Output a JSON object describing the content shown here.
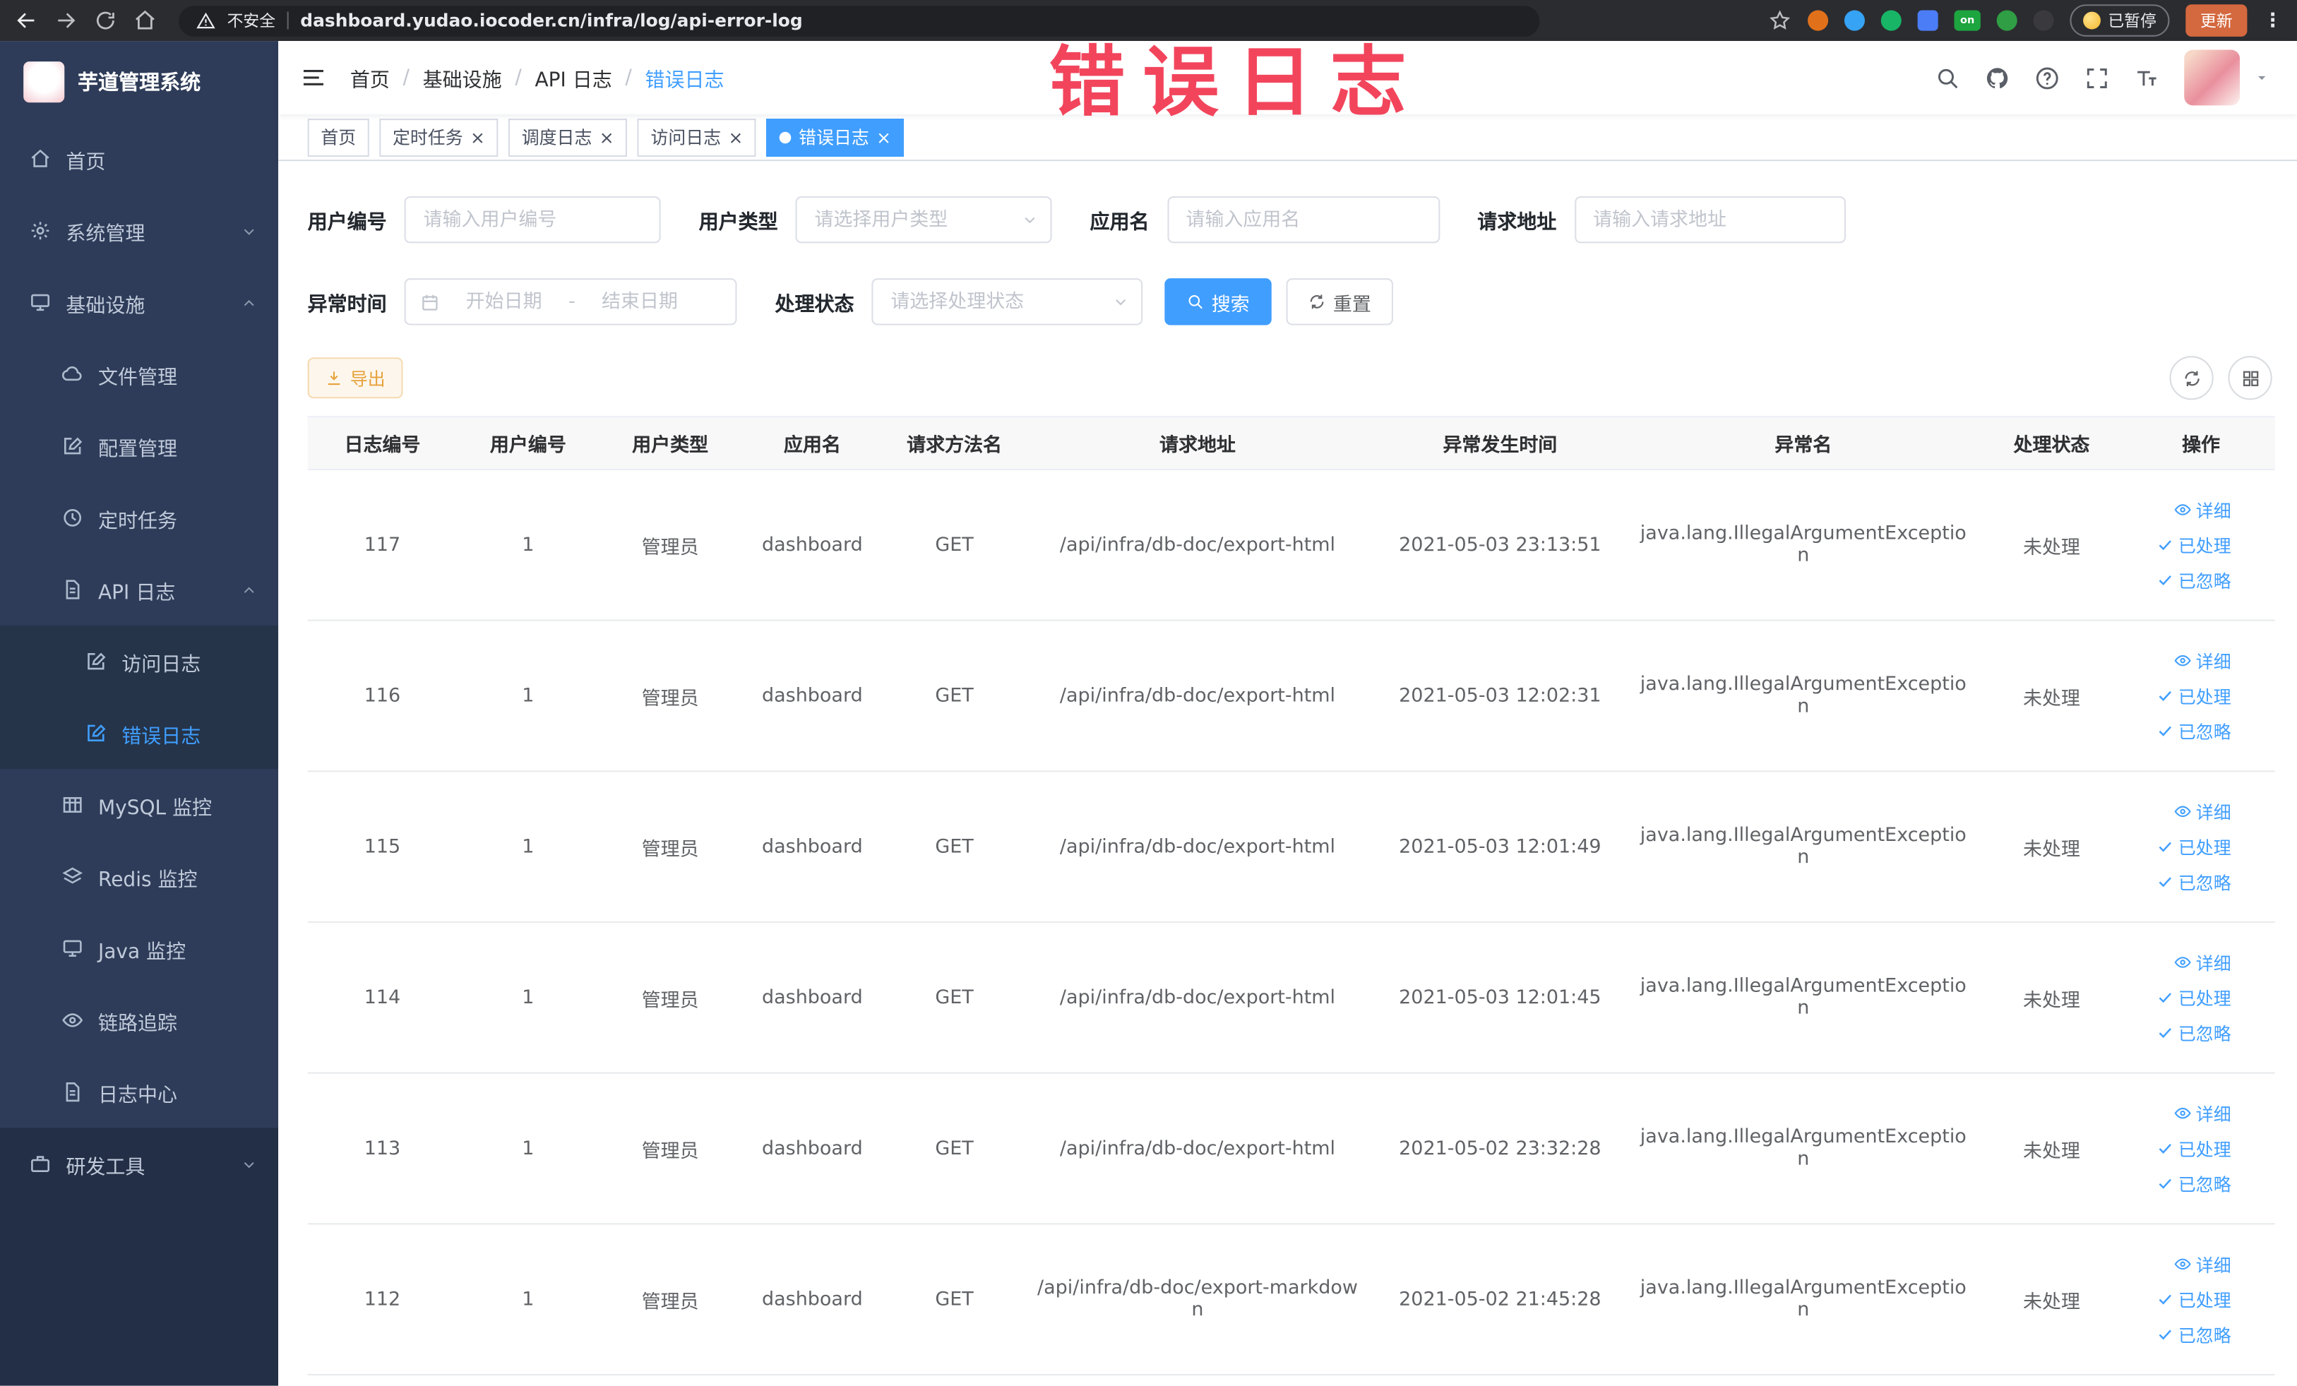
{
  "browser": {
    "security_text": "不安全",
    "url": "dashboard.yudao.iocoder.cn/infra/log/api-error-log",
    "ext_on": "on",
    "paused_badge": "已暂停",
    "update_label": "更新"
  },
  "annotation": {
    "text": "错误日志"
  },
  "sidebar": {
    "logo_title": "芋道管理系统",
    "items": [
      {
        "label": "首页"
      },
      {
        "label": "系统管理"
      },
      {
        "label": "基础设施"
      },
      {
        "label": "文件管理"
      },
      {
        "label": "配置管理"
      },
      {
        "label": "定时任务"
      },
      {
        "label": "API 日志"
      },
      {
        "label": "访问日志"
      },
      {
        "label": "错误日志"
      },
      {
        "label": "MySQL 监控"
      },
      {
        "label": "Redis 监控"
      },
      {
        "label": "Java 监控"
      },
      {
        "label": "链路追踪"
      },
      {
        "label": "日志中心"
      },
      {
        "label": "研发工具"
      }
    ]
  },
  "breadcrumb": {
    "items": [
      "首页",
      "基础设施",
      "API 日志",
      "错误日志"
    ]
  },
  "tabs": [
    {
      "label": "首页"
    },
    {
      "label": "定时任务"
    },
    {
      "label": "调度日志"
    },
    {
      "label": "访问日志"
    },
    {
      "label": "错误日志"
    }
  ],
  "filters": {
    "user_id_label": "用户编号",
    "user_id_placeholder": "请输入用户编号",
    "user_type_label": "用户类型",
    "user_type_placeholder": "请选择用户类型",
    "app_name_label": "应用名",
    "app_name_placeholder": "请输入应用名",
    "request_url_label": "请求地址",
    "request_url_placeholder": "请输入请求地址",
    "time_label": "异常时间",
    "start_placeholder": "开始日期",
    "range_separator": "-",
    "end_placeholder": "结束日期",
    "status_label": "处理状态",
    "status_placeholder": "请选择处理状态",
    "search_label": "搜索",
    "reset_label": "重置"
  },
  "toolbar": {
    "export_label": "导出"
  },
  "table": {
    "headers": [
      "日志编号",
      "用户编号",
      "用户类型",
      "应用名",
      "请求方法名",
      "请求地址",
      "异常发生时间",
      "异常名",
      "处理状态",
      "操作"
    ],
    "actions": {
      "detail": "详细",
      "processed": "已处理",
      "ignored": "已忽略"
    },
    "rows": [
      {
        "id": "117",
        "user_id": "1",
        "user_type": "管理员",
        "app": "dashboard",
        "method": "GET",
        "url": "/api/infra/db-doc/export-html",
        "time": "2021-05-03 23:13:51",
        "exception": "java.lang.IllegalArgumentException",
        "status": "未处理"
      },
      {
        "id": "116",
        "user_id": "1",
        "user_type": "管理员",
        "app": "dashboard",
        "method": "GET",
        "url": "/api/infra/db-doc/export-html",
        "time": "2021-05-03 12:02:31",
        "exception": "java.lang.IllegalArgumentException",
        "status": "未处理"
      },
      {
        "id": "115",
        "user_id": "1",
        "user_type": "管理员",
        "app": "dashboard",
        "method": "GET",
        "url": "/api/infra/db-doc/export-html",
        "time": "2021-05-03 12:01:49",
        "exception": "java.lang.IllegalArgumentException",
        "status": "未处理"
      },
      {
        "id": "114",
        "user_id": "1",
        "user_type": "管理员",
        "app": "dashboard",
        "method": "GET",
        "url": "/api/infra/db-doc/export-html",
        "time": "2021-05-03 12:01:45",
        "exception": "java.lang.IllegalArgumentException",
        "status": "未处理"
      },
      {
        "id": "113",
        "user_id": "1",
        "user_type": "管理员",
        "app": "dashboard",
        "method": "GET",
        "url": "/api/infra/db-doc/export-html",
        "time": "2021-05-02 23:32:28",
        "exception": "java.lang.IllegalArgumentException",
        "status": "未处理"
      },
      {
        "id": "112",
        "user_id": "1",
        "user_type": "管理员",
        "app": "dashboard",
        "method": "GET",
        "url": "/api/infra/db-doc/export-markdown",
        "time": "2021-05-02 21:45:28",
        "exception": "java.lang.IllegalArgumentException",
        "status": "未处理"
      }
    ]
  },
  "colors": {
    "accent": "#409EFF",
    "annotation": "#f2455c",
    "warning": "#e6a23c",
    "sidebar_bg": "#2e3c59"
  }
}
